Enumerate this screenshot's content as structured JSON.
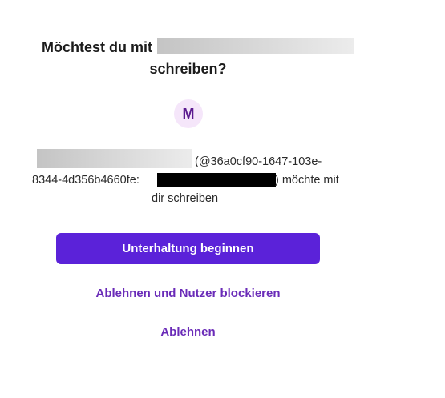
{
  "dialog": {
    "title_prefix": "Möchtest du mit",
    "title_suffix": "schreiben?",
    "avatar_initial": "M",
    "desc_line1": "(@36a0cf90-1647-103e-",
    "desc_line2_start": "8344-4d356b4660fe:",
    "desc_line2_end": ") möchte mit",
    "desc_line3": "dir schreiben",
    "primary_button": "Unterhaltung beginnen",
    "block_button": "Ablehnen und Nutzer blockieren",
    "decline_button": "Ablehnen"
  },
  "colors": {
    "primary": "#5b22d9",
    "link": "#6a2bb8",
    "avatar_bg": "#f5e6fa",
    "avatar_text": "#5b1a8f"
  }
}
